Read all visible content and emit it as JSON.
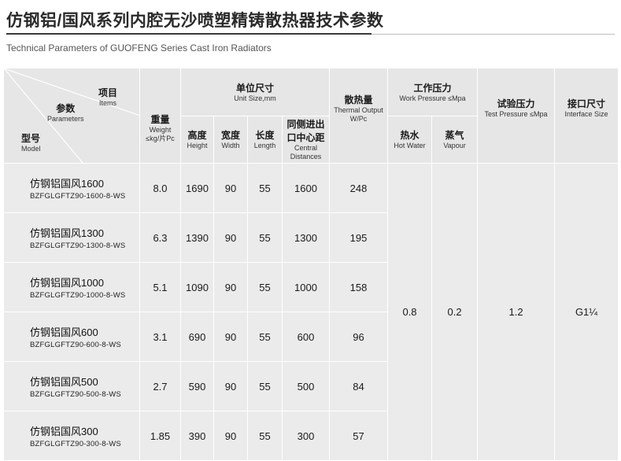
{
  "header": {
    "title": "仿钢铝/国风系列内腔无沙喷塑精铸散热器技术参数",
    "subtitle": "Technical Parameters of GUOFENG Series Cast Iron Radiators"
  },
  "table": {
    "corner": {
      "items_zh": "项目",
      "items_en": "Items",
      "params_zh": "参数",
      "params_en": "Parameters",
      "model_zh": "型号",
      "model_en": "Model"
    },
    "weight": {
      "zh": "重量",
      "en1": "Weight",
      "en2": "≤kg/片Pc"
    },
    "unit_size": {
      "zh": "单位尺寸",
      "en": "Unit Size,mm"
    },
    "height": {
      "zh": "高度",
      "en": "Height"
    },
    "width": {
      "zh": "宽度",
      "en": "Width"
    },
    "length": {
      "zh": "长度",
      "en": "Length"
    },
    "central": {
      "zh1": "同侧进出",
      "zh2": "口中心距",
      "en1": "Central",
      "en2": "Distances"
    },
    "thermal": {
      "zh": "散热量",
      "en1": "Thermal Output",
      "en2": "W/Pc"
    },
    "work_pressure": {
      "zh": "工作压力",
      "en": "Work Pressure ≤Mpa"
    },
    "hot_water": {
      "zh": "热水",
      "en": "Hot Water"
    },
    "vapour": {
      "zh": "蒸气",
      "en": "Vapour"
    },
    "test_pressure": {
      "zh": "试验压力",
      "en": "Test Pressure ≤Mpa"
    },
    "interface": {
      "zh": "接口尺寸",
      "en": "Interface Size"
    },
    "shared": {
      "hot_water": "0.8",
      "vapour": "0.2",
      "test_pressure": "1.2",
      "interface": "G1¼"
    },
    "rows": [
      {
        "name": "仿钢铝国风1600",
        "code": "BZFGLGFTZ90-1600-8-WS",
        "weight": "8.0",
        "height": "1690",
        "width": "90",
        "length": "55",
        "central": "1600",
        "thermal": "248"
      },
      {
        "name": "仿钢铝国风1300",
        "code": "BZFGLGFTZ90-1300-8-WS",
        "weight": "6.3",
        "height": "1390",
        "width": "90",
        "length": "55",
        "central": "1300",
        "thermal": "195"
      },
      {
        "name": "仿钢铝国风1000",
        "code": "BZFGLGFTZ90-1000-8-WS",
        "weight": "5.1",
        "height": "1090",
        "width": "90",
        "length": "55",
        "central": "1000",
        "thermal": "158"
      },
      {
        "name": "仿钢铝国风600",
        "code": "BZFGLGFTZ90-600-8-WS",
        "weight": "3.1",
        "height": "690",
        "width": "90",
        "length": "55",
        "central": "600",
        "thermal": "96"
      },
      {
        "name": "仿钢铝国风500",
        "code": "BZFGLGFTZ90-500-8-WS",
        "weight": "2.7",
        "height": "590",
        "width": "90",
        "length": "55",
        "central": "500",
        "thermal": "84"
      },
      {
        "name": "仿钢铝国风300",
        "code": "BZFGLGFTZ90-300-8-WS",
        "weight": "1.85",
        "height": "390",
        "width": "90",
        "length": "55",
        "central": "300",
        "thermal": "57"
      }
    ]
  }
}
